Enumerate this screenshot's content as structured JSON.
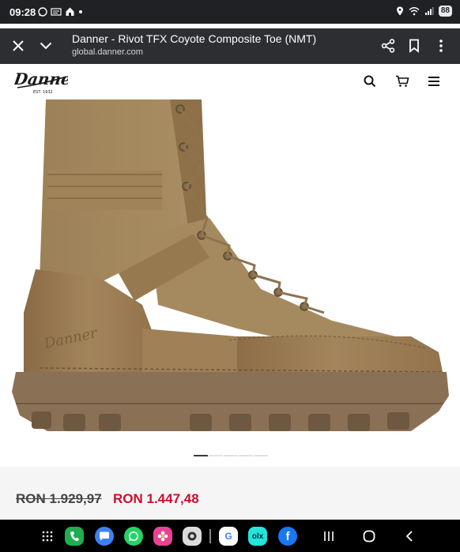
{
  "status_bar": {
    "time": "09:28",
    "battery": "88",
    "left_icons": [
      "whatsapp-icon",
      "news-icon",
      "home-icon",
      "dot-icon"
    ],
    "right_icons": [
      "location-icon",
      "wifi-icon",
      "signal-icon"
    ]
  },
  "browser": {
    "title": "Danner - Rivot TFX Coyote Composite Toe (NMT)",
    "url": "global.danner.com"
  },
  "site": {
    "logo_text": "Danner",
    "logo_subtext": "EST. 1932"
  },
  "product": {
    "image_alt": "Danner Rivot TFX Coyote Composite Toe boot",
    "carousel_count": 5,
    "carousel_active": 0,
    "old_price": "RON 1.929,97",
    "new_price": "RON 1.447,48"
  },
  "colors": {
    "accent_price": "#c8102e",
    "boot": "#9c7d53",
    "toolbar": "#2d2e31"
  },
  "nav": {
    "dock_apps": [
      "apps-grid-icon",
      "phone-icon",
      "messages-icon",
      "whatsapp-icon",
      "gallery-icon",
      "camera-icon",
      "google-icon",
      "olx-icon",
      "facebook-icon"
    ],
    "olx_label": "olx",
    "google_label": "G",
    "facebook_label": "f",
    "buttons": [
      "recents-button",
      "home-button",
      "back-button"
    ]
  }
}
